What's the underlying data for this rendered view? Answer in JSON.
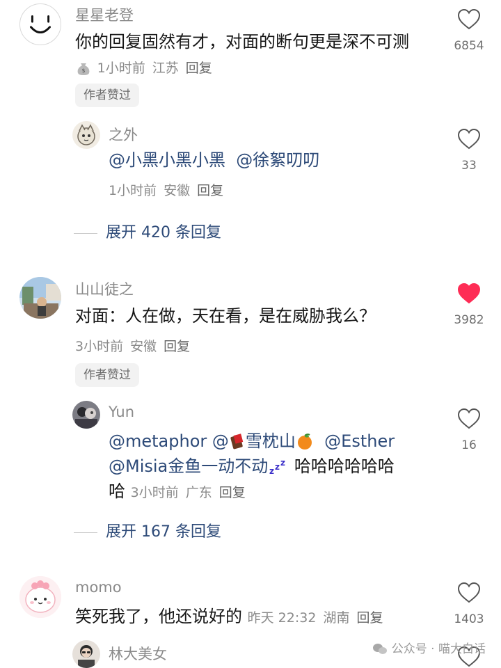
{
  "badge_label": "作者赞过",
  "reply_label": "回复",
  "comments": [
    {
      "user": "星星老登",
      "text": "你的回复固然有才，对面的断句更是深不可测",
      "time": "1小时前",
      "location": "江苏",
      "likes": "6854",
      "liked": false,
      "author_liked": true
    },
    {
      "user": "之外",
      "mention1": "@小黑小黑小黑",
      "mention2": "@徐絮叨叨",
      "time": "1小时前",
      "location": "安徽",
      "likes": "33",
      "liked": false
    },
    {
      "user": "山山徒之",
      "text": "对面：人在做，天在看，是在威胁我么？",
      "time": "3小时前",
      "location": "安徽",
      "likes": "3982",
      "liked": true,
      "author_liked": true
    },
    {
      "user": "Yun",
      "mention1": "@metaphor",
      "mention2": "@",
      "mention2_rest": "雪枕山",
      "mention3": "@Esther",
      "mention4": "@Misia金鱼一动不动",
      "text_tail": "哈哈哈哈哈哈",
      "text_tail2": "哈",
      "time": "3小时前",
      "location": "广东",
      "likes": "16",
      "liked": false
    },
    {
      "user": "momo",
      "text": "笑死我了，他还说好的",
      "time": "昨天 22:32",
      "location": "湖南",
      "likes": "1403",
      "liked": false
    },
    {
      "user": "林大美女"
    }
  ],
  "expand_replies": [
    "展开 420 条回复",
    "展开 167 条回复"
  ],
  "watermark": "公众号 · 喵大白话",
  "colors": {
    "like_active": "#fe2c55",
    "mention": "#2d4a78",
    "muted": "#8a8a8a"
  }
}
